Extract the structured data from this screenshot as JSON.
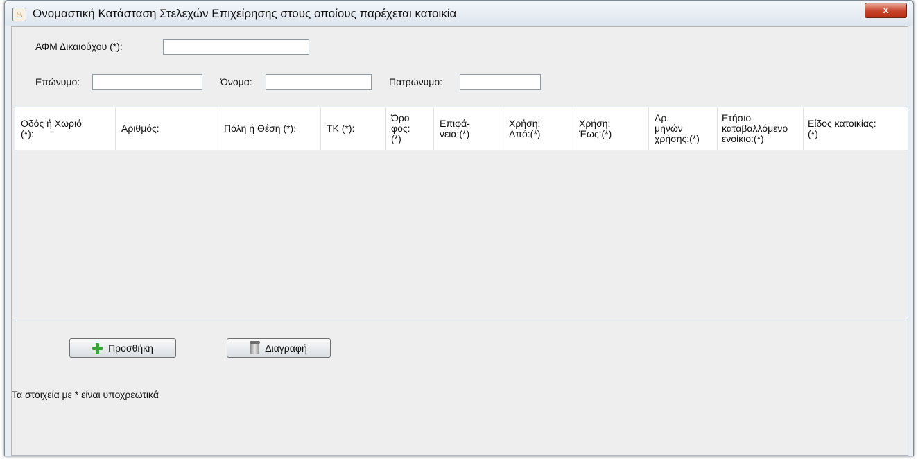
{
  "window": {
    "title": "Ονομαστική Κατάσταση Στελεχών Επιχείρησης στους οποίους παρέχεται κατοικία",
    "close_label": "x"
  },
  "form": {
    "afm_label": "ΑΦΜ Δικαιούχου (*):",
    "afm_value": "",
    "surname_label": "Επώνυμο:",
    "surname_value": "",
    "name_label": "Όνομα:",
    "name_value": "",
    "father_label": "Πατρώνυμο:",
    "father_value": ""
  },
  "table": {
    "columns": [
      "Οδός ή Χωριό\n(*):",
      "Αριθμός:",
      "Πόλη ή Θέση (*):",
      "ΤΚ (*):",
      "Όρο\nφος:\n(*)",
      "Επιφά-\nνεια:(*)",
      "Χρήση:\nΑπό:(*)",
      "Χρήση:\nΈως:(*)",
      "Αρ.\nμηνών\nχρήσης:(*)",
      "Ετήσιο\nκαταβαλλόμενο\nενοίκιο:(*)",
      "Είδος κατοικίας:\n(*)"
    ],
    "rows": []
  },
  "buttons": {
    "add_label": "Προσθήκη",
    "delete_label": "Διαγραφή"
  },
  "note": "Τα στοιχεία με * είναι υποχρεωτικά",
  "icons": {
    "add": "plus-icon",
    "delete": "trash-icon",
    "app": "java-icon"
  },
  "colors": {
    "close": "#c7432a",
    "add_icon": "#3aa23a"
  }
}
